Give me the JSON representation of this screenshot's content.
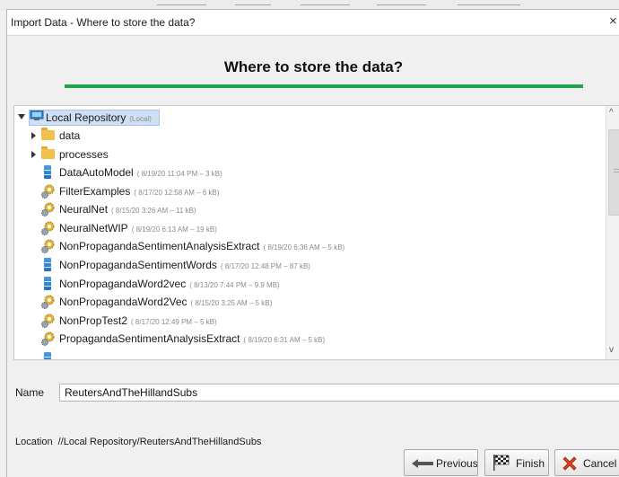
{
  "dialog": {
    "title": "Import Data - Where to store the data?",
    "close_glyph": "×",
    "heading": "Where to store the data?"
  },
  "tree": {
    "root": {
      "label": "Local Repository",
      "meta": "(Local)",
      "icon": "computer-icon"
    },
    "folders": [
      {
        "label": "data",
        "icon": "folder-icon"
      },
      {
        "label": "processes",
        "icon": "folder-icon"
      }
    ],
    "entries": [
      {
        "label": "DataAutoModel",
        "meta": "( 8/19/20 11:04 PM – 3 kB)",
        "icon": "data-icon"
      },
      {
        "label": "FilterExamples",
        "meta": "( 8/17/20 12:58 AM – 6 kB)",
        "icon": "gear-icon"
      },
      {
        "label": "NeuralNet",
        "meta": "( 8/15/20 3:26 AM – 11 kB)",
        "icon": "gear-icon"
      },
      {
        "label": "NeuralNetWIP",
        "meta": "( 8/19/20 6:13 AM – 19 kB)",
        "icon": "gear-icon"
      },
      {
        "label": "NonPropagandaSentimentAnalysisExtract",
        "meta": "( 8/19/20 6:36 AM – 5 kB)",
        "icon": "gear-icon"
      },
      {
        "label": "NonPropagandaSentimentWords",
        "meta": "( 8/17/20 12:48 PM – 87 kB)",
        "icon": "data-icon"
      },
      {
        "label": "NonPropagandaWord2vec",
        "meta": "( 8/13/20 7:44 PM – 9.9 MB)",
        "icon": "data-icon"
      },
      {
        "label": "NonPropagandaWord2Vec",
        "meta": "( 8/15/20 3:25 AM – 5 kB)",
        "icon": "gear-icon"
      },
      {
        "label": "NonPropTest2",
        "meta": "( 8/17/20 12:49 PM – 5 kB)",
        "icon": "gear-icon"
      },
      {
        "label": "PropagandaSentimentAnalysisExtract",
        "meta": "( 8/19/20 6:31 AM – 5 kB)",
        "icon": "gear-icon"
      }
    ],
    "scroll_up": "^",
    "scroll_down": "v"
  },
  "name_field": {
    "label": "Name",
    "value": "ReutersAndTheHillandSubs"
  },
  "location": {
    "label": "Location",
    "value": "//Local Repository/ReutersAndTheHillandSubs"
  },
  "buttons": {
    "previous": "Previous",
    "finish": "Finish",
    "cancel": "Cancel"
  },
  "colors": {
    "accent_bar": "#21a24e",
    "selection": "#cfe0f5",
    "cancel_x": "#d9421a"
  }
}
